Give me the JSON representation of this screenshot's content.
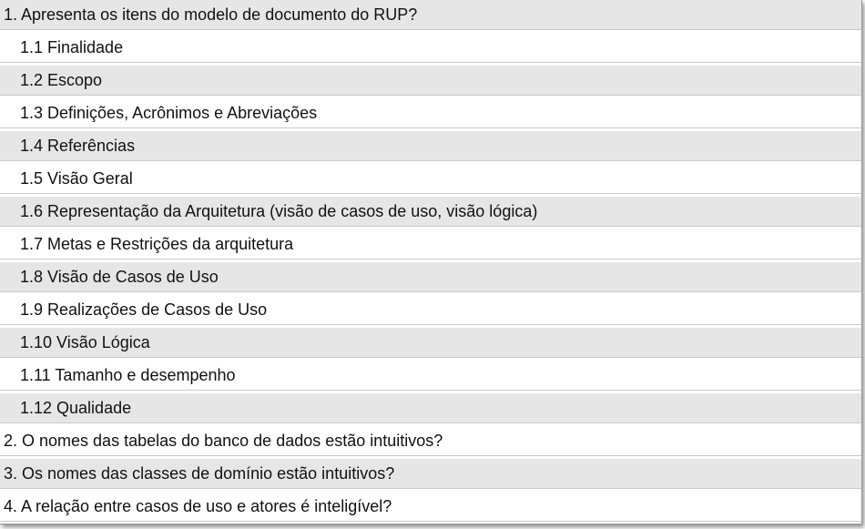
{
  "checklist": {
    "items": [
      {
        "text": "1. Apresenta os itens do modelo de documento do RUP?",
        "level": "top",
        "shade": true
      },
      {
        "text": "1.1 Finalidade",
        "level": "sub",
        "shade": false
      },
      {
        "text": "1.2 Escopo",
        "level": "sub",
        "shade": true
      },
      {
        "text": "1.3 Definições, Acrônimos e Abreviações",
        "level": "sub",
        "shade": false
      },
      {
        "text": "1.4 Referências",
        "level": "sub",
        "shade": true
      },
      {
        "text": "1.5 Visão Geral",
        "level": "sub",
        "shade": false
      },
      {
        "text": "1.6 Representação da Arquitetura (visão de casos de uso, visão lógica)",
        "level": "sub",
        "shade": true
      },
      {
        "text": "1.7 Metas e Restrições da arquitetura",
        "level": "sub",
        "shade": false
      },
      {
        "text": "1.8 Visão de Casos de Uso",
        "level": "sub",
        "shade": true
      },
      {
        "text": "1.9 Realizações de Casos de Uso",
        "level": "sub",
        "shade": false
      },
      {
        "text": "1.10 Visão Lógica",
        "level": "sub",
        "shade": true
      },
      {
        "text": "1.11  Tamanho e desempenho",
        "level": "sub",
        "shade": false
      },
      {
        "text": "1.12 Qualidade",
        "level": "sub",
        "shade": true
      },
      {
        "text": "2. O nomes das tabelas do banco de dados estão intuitivos?",
        "level": "top",
        "shade": false
      },
      {
        "text": "3. Os nomes das classes de domínio estão intuitivos?",
        "level": "top",
        "shade": true
      },
      {
        "text": "4. A relação entre casos de uso e atores é inteligível?",
        "level": "top",
        "shade": false
      }
    ]
  }
}
